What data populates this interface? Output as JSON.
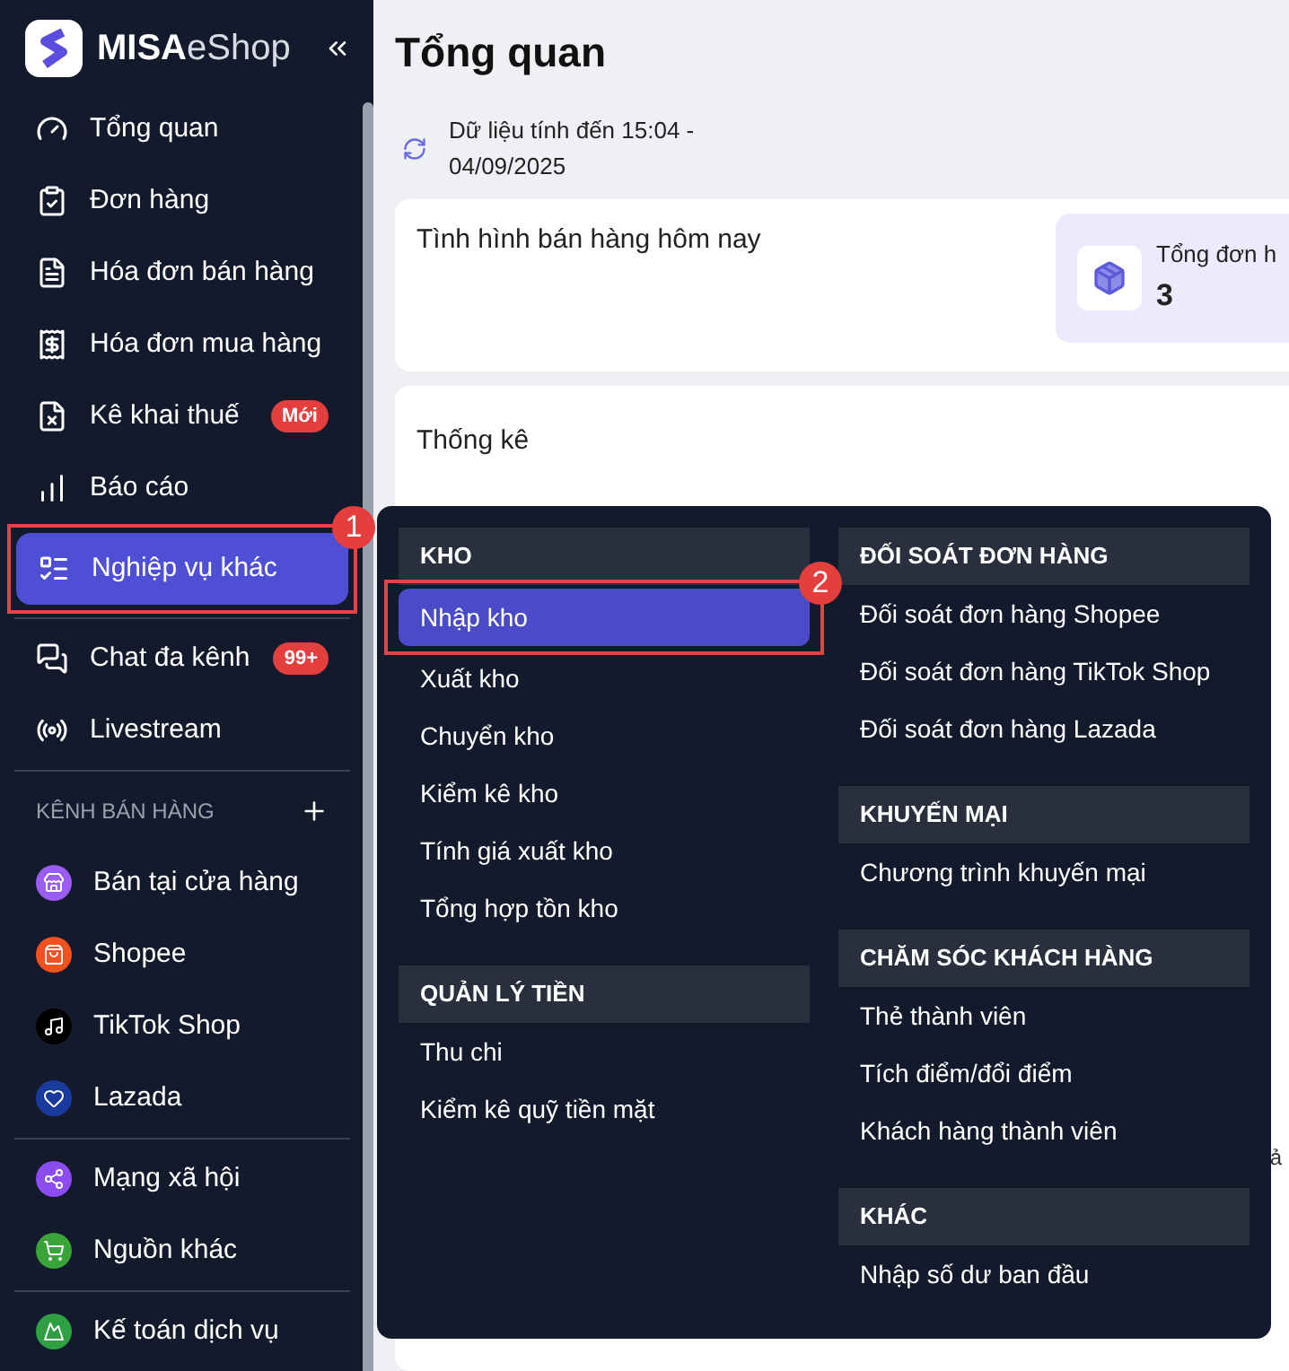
{
  "logo": {
    "brand": "MISA",
    "product": "eShop"
  },
  "sidebar": {
    "groups": [
      {
        "items": [
          {
            "label": "Tổng quan",
            "selected": false
          },
          {
            "label": "Đơn hàng",
            "selected": false
          },
          {
            "label": "Hóa đơn bán hàng",
            "selected": false
          },
          {
            "label": "Hóa đơn mua hàng",
            "selected": false
          },
          {
            "label": "Kê khai thuế",
            "selected": false,
            "badge": "Mới"
          },
          {
            "label": "Báo cáo",
            "selected": false
          },
          {
            "label": "Nghiệp vụ khác",
            "selected": true,
            "callout": "1"
          }
        ]
      },
      {
        "items": [
          {
            "label": "Chat đa kênh",
            "selected": false,
            "badge": "99+"
          },
          {
            "label": "Livestream",
            "selected": false
          }
        ]
      },
      {
        "section": "KÊNH BÁN HÀNG",
        "items": [
          {
            "label": "Bán tại cửa hàng",
            "selected": false,
            "color": "#9b5cf0"
          },
          {
            "label": "Shopee",
            "selected": false,
            "color": "#f4511e"
          },
          {
            "label": "TikTok Shop",
            "selected": false,
            "color": "#000000"
          },
          {
            "label": "Lazada",
            "selected": false,
            "color": "#1a3a9e"
          }
        ]
      },
      {
        "items": [
          {
            "label": "Mạng xã hội",
            "selected": false,
            "color": "#8b4cf0"
          },
          {
            "label": "Nguồn khác",
            "selected": false,
            "color": "#3aa33a"
          }
        ]
      },
      {
        "items": [
          {
            "label": "Kế toán dịch vụ",
            "selected": false,
            "color": "#2ea043"
          }
        ]
      }
    ]
  },
  "main": {
    "title": "Tổng quan",
    "updated": "Dữ liệu tính đến 15:04 - 04/09/2025",
    "sales_card": {
      "title": "Tình hình bán hàng hôm nay",
      "stat": {
        "label": "Tổng đơn h",
        "value": "3"
      }
    },
    "stats_card": {
      "title": "Thống kê"
    },
    "column_1": "ả"
  },
  "menu": {
    "columns": [
      [
        {
          "title": "KHO",
          "items": [
            {
              "label": "Nhập kho",
              "selected": true,
              "callout": "2"
            },
            {
              "label": "Xuất kho",
              "selected": false
            },
            {
              "label": "Chuyển kho",
              "selected": false
            },
            {
              "label": "Kiểm kê kho",
              "selected": false
            },
            {
              "label": "Tính giá xuất kho",
              "selected": false
            },
            {
              "label": "Tổng hợp tồn kho",
              "selected": false
            }
          ]
        },
        {
          "title": "QUẢN LÝ TIỀN",
          "items": [
            {
              "label": "Thu chi",
              "selected": false
            },
            {
              "label": "Kiểm kê quỹ tiền mặt",
              "selected": false
            }
          ]
        }
      ],
      [
        {
          "title": "ĐỐI SOÁT ĐƠN HÀNG",
          "items": [
            {
              "label": "Đối soát đơn hàng Shopee",
              "selected": false
            },
            {
              "label": "Đối soát đơn hàng TikTok Shop",
              "selected": false
            },
            {
              "label": "Đối soát đơn hàng Lazada",
              "selected": false
            }
          ]
        },
        {
          "title": "KHUYẾN MẠI",
          "items": [
            {
              "label": "Chương trình khuyến mại",
              "selected": false
            }
          ]
        },
        {
          "title": "CHĂM SÓC KHÁCH HÀNG",
          "items": [
            {
              "label": "Thẻ thành viên",
              "selected": false
            },
            {
              "label": "Tích điểm/đổi điểm",
              "selected": false
            },
            {
              "label": "Khách hàng thành viên",
              "selected": false
            }
          ]
        },
        {
          "title": "KHÁC",
          "items": [
            {
              "label": "Nhập số dư ban đầu",
              "selected": false
            }
          ]
        }
      ]
    ]
  }
}
